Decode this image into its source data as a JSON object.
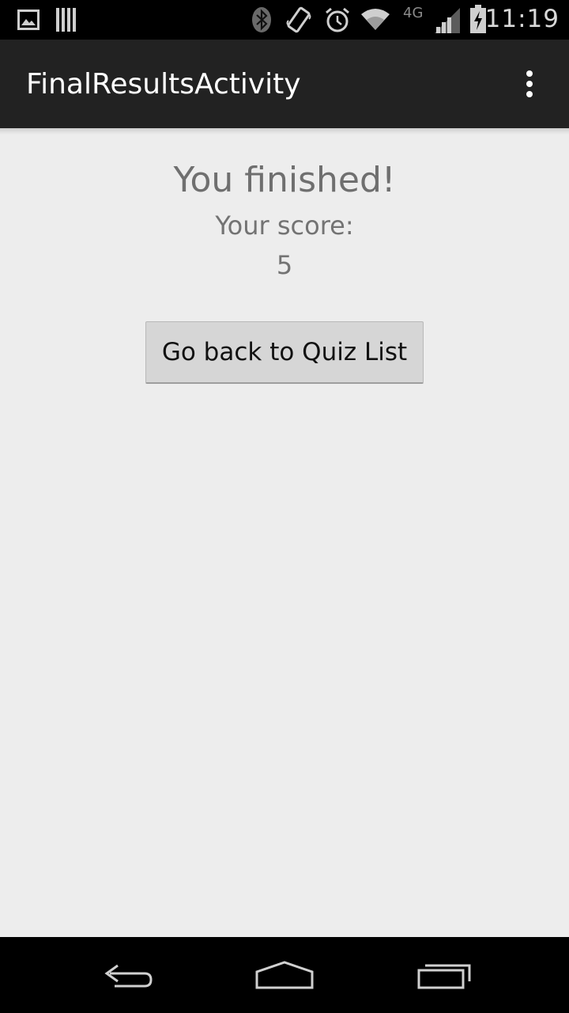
{
  "status_bar": {
    "time": "11:19",
    "network_type": "4G",
    "icons": [
      "image-icon",
      "barcode-icon",
      "bluetooth-icon",
      "vibrate-icon",
      "alarm-icon",
      "wifi-icon",
      "signal-icon",
      "battery-charging-icon"
    ]
  },
  "action_bar": {
    "title": "FinalResultsActivity",
    "overflow_icon": "overflow-menu-icon"
  },
  "main": {
    "heading": "You finished!",
    "score_label": "Your score:",
    "score_value": "5",
    "button_label": "Go back to Quiz List"
  },
  "nav_bar": {
    "icons": [
      "back-icon",
      "home-icon",
      "recent-apps-icon"
    ]
  },
  "colors": {
    "action_bar": "#222222",
    "content_background": "#ededed",
    "button_background": "#d6d6d6",
    "text_gray": "#6f6f6f"
  }
}
